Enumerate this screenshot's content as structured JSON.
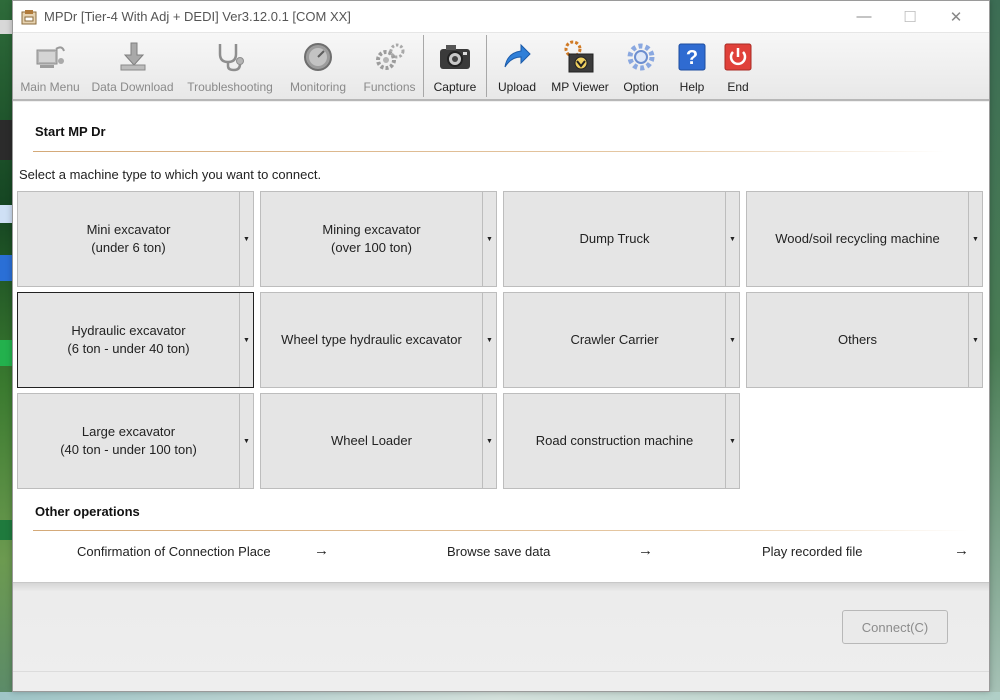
{
  "window": {
    "title": "MPDr [Tier-4 With Adj + DEDI] Ver3.12.0.1 [COM XX]",
    "minimize": "—",
    "maximize": "☐",
    "close": "✕"
  },
  "toolbar": {
    "buttons": [
      {
        "label": "Main Menu",
        "icon": "computer-icon",
        "enabled": false
      },
      {
        "label": "Data Download",
        "icon": "download-icon",
        "enabled": false
      },
      {
        "label": "Troubleshooting",
        "icon": "stethoscope-icon",
        "enabled": false
      },
      {
        "label": "Monitoring",
        "icon": "gauge-icon",
        "enabled": false
      },
      {
        "label": "Functions",
        "icon": "gears-icon",
        "enabled": false
      },
      {
        "label": "Capture",
        "icon": "camera-icon",
        "enabled": true
      },
      {
        "label": "Upload",
        "icon": "upload-arrow-icon",
        "enabled": true
      },
      {
        "label": "MP Viewer",
        "icon": "viewer-icon",
        "enabled": true
      },
      {
        "label": "Option",
        "icon": "option-gear-icon",
        "enabled": true
      },
      {
        "label": "Help",
        "icon": "help-icon",
        "enabled": true
      },
      {
        "label": "End",
        "icon": "power-icon",
        "enabled": true
      }
    ]
  },
  "start": {
    "title": "Start MP Dr",
    "instruction": "Select a machine type to which you want to connect."
  },
  "machines": [
    {
      "line1": "Mini excavator",
      "line2": "(under 6 ton)"
    },
    {
      "line1": "Mining excavator",
      "line2": "(over 100 ton)"
    },
    {
      "line1": "Dump Truck",
      "line2": ""
    },
    {
      "line1": "Wood/soil recycling machine",
      "line2": ""
    },
    {
      "line1": "Hydraulic excavator",
      "line2": "(6 ton - under 40 ton)"
    },
    {
      "line1": "Wheel type hydraulic excavator",
      "line2": ""
    },
    {
      "line1": "Crawler Carrier",
      "line2": ""
    },
    {
      "line1": "Others",
      "line2": ""
    },
    {
      "line1": "Large excavator",
      "line2": "(40 ton - under 100 ton)"
    },
    {
      "line1": "Wheel Loader",
      "line2": ""
    },
    {
      "line1": "Road construction machine",
      "line2": ""
    }
  ],
  "dropdown_glyph": "▼",
  "other_ops": {
    "title": "Other operations",
    "items": [
      {
        "label": "Confirmation of Connection Place",
        "arrow": "→"
      },
      {
        "label": "Browse save data",
        "arrow": "→"
      },
      {
        "label": "Play recorded file",
        "arrow": "→"
      }
    ]
  },
  "footer": {
    "connect_label": "Connect(C)"
  },
  "colors": {
    "accent_line": "#d4a978",
    "button_bg": "#e5e5e5",
    "help_blue": "#2f6bd1",
    "end_red": "#e0413a"
  }
}
